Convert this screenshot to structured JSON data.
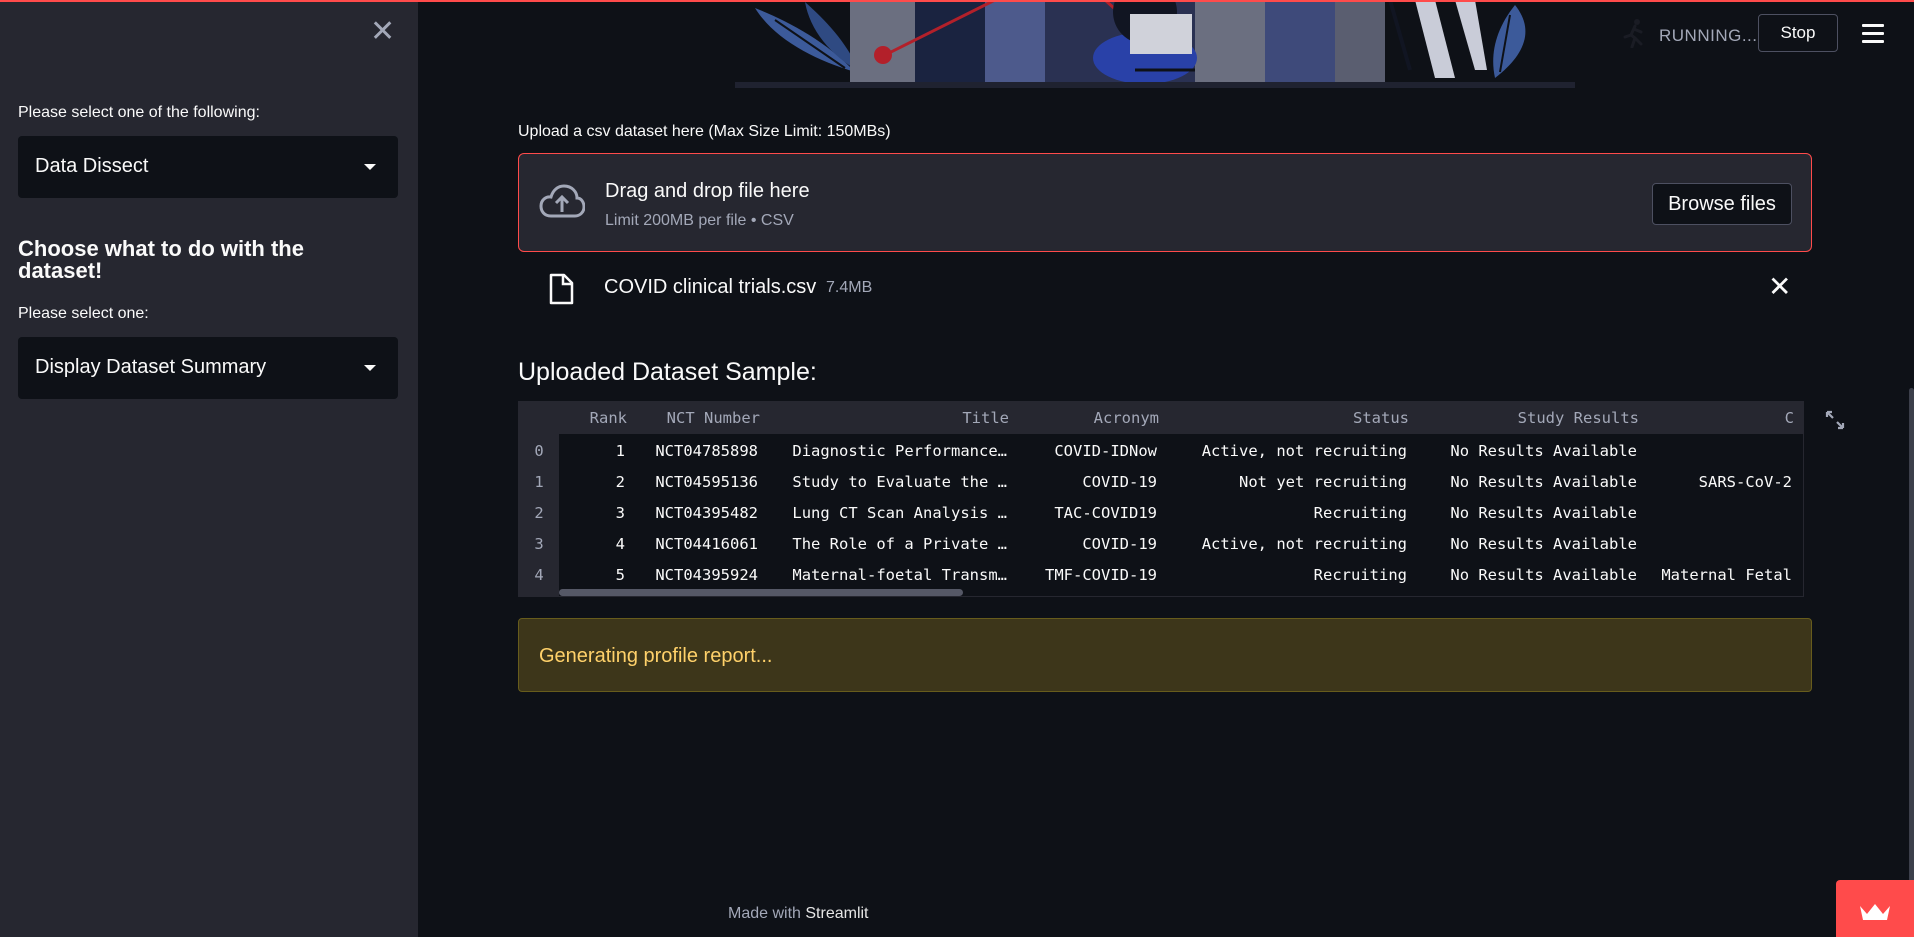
{
  "sidebar": {
    "select1_label": "Please select one of the following:",
    "select1_value": "Data Dissect",
    "heading": "Choose what to do with the dataset!",
    "select2_label": "Please select one:",
    "select2_value": "Display Dataset Summary",
    "close_glyph": "✕"
  },
  "header": {
    "status": "RUNNING...",
    "stop_label": "Stop"
  },
  "uploader": {
    "label": "Upload a csv dataset here (Max Size Limit: 150MBs)",
    "drop_title": "Drag and drop file here",
    "drop_limit": "Limit 200MB per file • CSV",
    "browse_label": "Browse files",
    "file_name": "COVID clinical trials.csv",
    "file_size": "7.4MB",
    "remove_glyph": "✕"
  },
  "sample": {
    "title": "Uploaded Dataset Sample:",
    "columns": [
      "Rank",
      "NCT Number",
      "Title",
      "Acronym",
      "Status",
      "Study Results",
      "C"
    ],
    "rows": [
      {
        "index": "0",
        "cells": [
          "1",
          "NCT04785898",
          "Diagnostic Performance…",
          "COVID-IDNow",
          "Active, not recruiting",
          "No Results Available",
          ""
        ]
      },
      {
        "index": "1",
        "cells": [
          "2",
          "NCT04595136",
          "Study to Evaluate the …",
          "COVID-19",
          "Not yet recruiting",
          "No Results Available",
          "SARS-CoV-2"
        ]
      },
      {
        "index": "2",
        "cells": [
          "3",
          "NCT04395482",
          "Lung CT Scan Analysis …",
          "TAC-COVID19",
          "Recruiting",
          "No Results Available",
          ""
        ]
      },
      {
        "index": "3",
        "cells": [
          "4",
          "NCT04416061",
          "The Role of a Private …",
          "COVID-19",
          "Active, not recruiting",
          "No Results Available",
          ""
        ]
      },
      {
        "index": "4",
        "cells": [
          "5",
          "NCT04395924",
          "Maternal-foetal Transm…",
          "TMF-COVID-19",
          "Recruiting",
          "No Results Available",
          "Maternal Fetal"
        ]
      }
    ]
  },
  "warning": {
    "text": "Generating profile report..."
  },
  "footer": {
    "prefix": "Made with ",
    "link": "Streamlit"
  },
  "colors": {
    "accent": "#ff4b4b",
    "sidebar_bg": "#262730",
    "main_bg": "#0e1117",
    "warning_text": "#ffd16a"
  },
  "icons": [
    "close-icon",
    "caret-down-icon",
    "running-icon",
    "hamburger-menu-icon",
    "cloud-upload-icon",
    "file-icon",
    "expand-icon",
    "streamlit-crown-icon"
  ]
}
